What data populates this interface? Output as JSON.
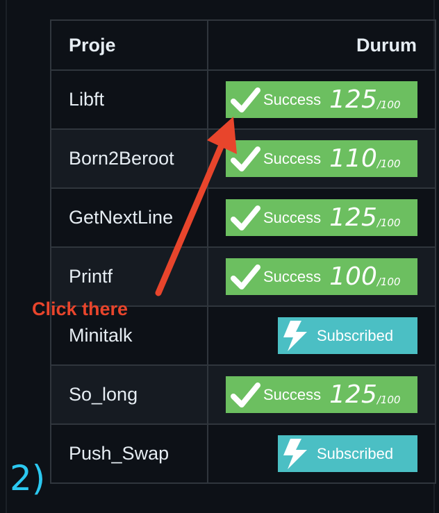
{
  "table": {
    "headers": {
      "project": "Proje",
      "status": "Durum"
    },
    "rows": [
      {
        "name": "Libft",
        "status": "success",
        "label": "Success",
        "score": "125",
        "max": "/100"
      },
      {
        "name": "Born2Beroot",
        "status": "success",
        "label": "Success",
        "score": "110",
        "max": "/100"
      },
      {
        "name": "GetNextLine",
        "status": "success",
        "label": "Success",
        "score": "125",
        "max": "/100"
      },
      {
        "name": "Printf",
        "status": "success",
        "label": "Success",
        "score": "100",
        "max": "/100"
      },
      {
        "name": "Minitalk",
        "status": "subscribed",
        "label": "Subscribed"
      },
      {
        "name": "So_long",
        "status": "success",
        "label": "Success",
        "score": "125",
        "max": "/100"
      },
      {
        "name": "Push_Swap",
        "status": "subscribed",
        "label": "Subscribed"
      }
    ]
  },
  "annotation": {
    "text": "Click there",
    "color": "#e8452c"
  },
  "step_label": "2)",
  "colors": {
    "success_badge": "#6cbf60",
    "subscribed_badge": "#4bbfc4",
    "background": "#0d1117",
    "step_label": "#2bc8f0"
  },
  "icons": {
    "success": "check-icon",
    "subscribed": "lightning-icon"
  }
}
